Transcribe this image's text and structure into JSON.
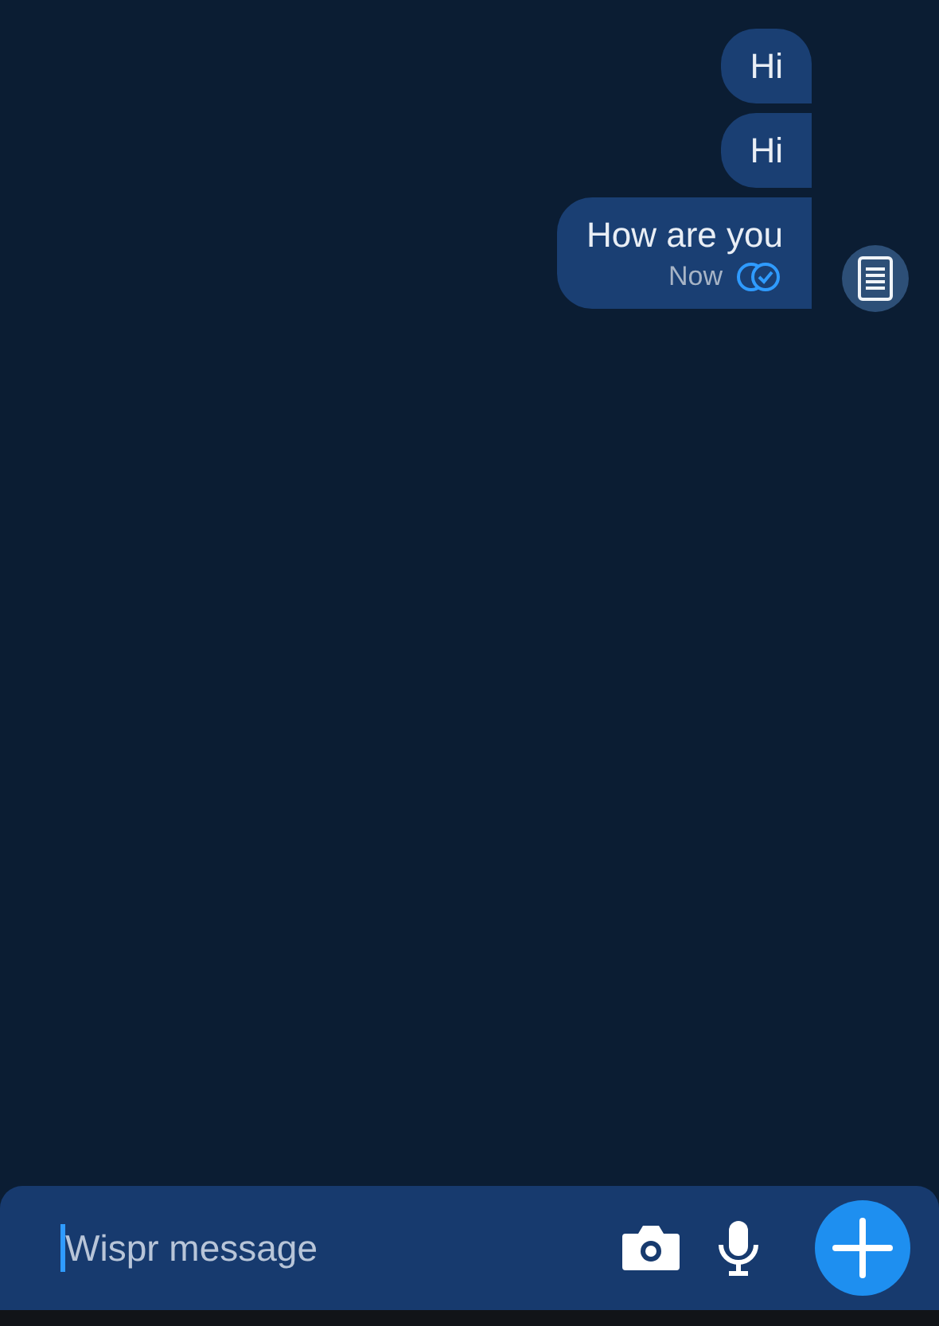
{
  "messages": [
    {
      "text": "Hi"
    },
    {
      "text": "Hi"
    },
    {
      "text": "How are you",
      "time": "Now",
      "read": true
    }
  ],
  "composer": {
    "placeholder": "Wispr message"
  }
}
